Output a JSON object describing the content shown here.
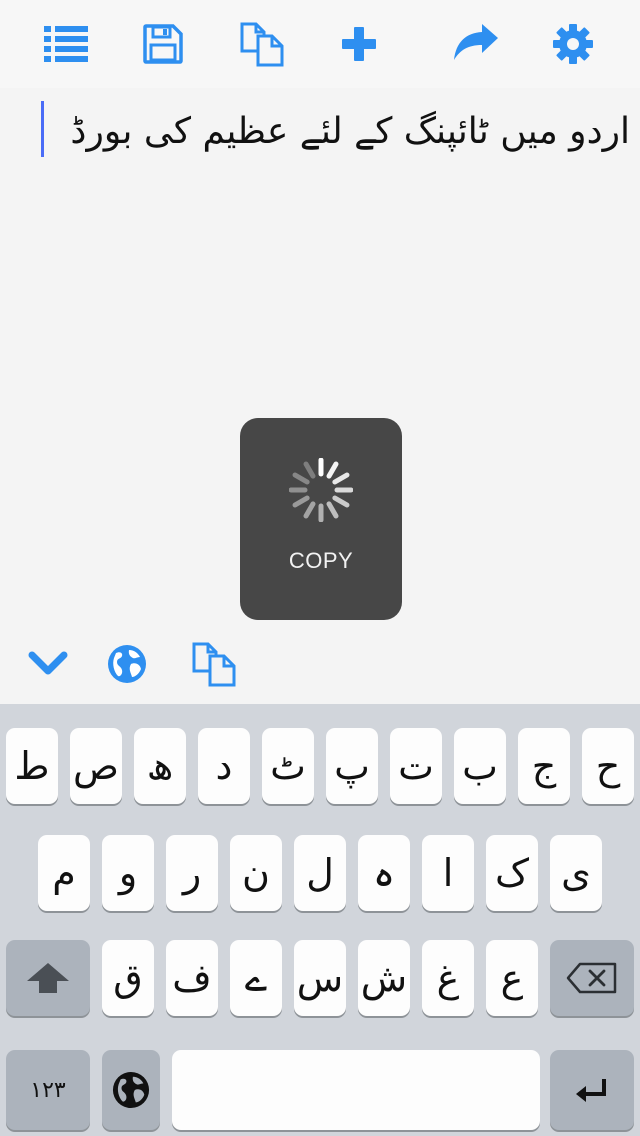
{
  "toolbar": {
    "icons": [
      "list-icon",
      "save-icon",
      "copy-icon",
      "plus-icon",
      "share-icon",
      "gear-icon"
    ],
    "accent": "#2e8ff0"
  },
  "editor": {
    "text": "اردو میں ٹائپنگ کے لئے عظیم کی بورڈ",
    "cursor_color": "#4a6cf7"
  },
  "hud": {
    "label": "COPY"
  },
  "accessory": {
    "icons": [
      "chevron-down-icon",
      "globe-icon",
      "copy-icon"
    ]
  },
  "keyboard": {
    "row1": [
      "ط",
      "ص",
      "ھ",
      "د",
      "ٹ",
      "پ",
      "ت",
      "ب",
      "ج",
      "ح"
    ],
    "row2": [
      "م",
      "و",
      "ر",
      "ن",
      "ل",
      "ہ",
      "ا",
      "ک",
      "ی"
    ],
    "row3": [
      "ق",
      "ف",
      "ے",
      "س",
      "ش",
      "غ",
      "ع"
    ],
    "numbers_label": "۱۲۳",
    "icons": [
      "shift-icon",
      "backspace-icon",
      "globe-icon",
      "return-icon"
    ]
  }
}
